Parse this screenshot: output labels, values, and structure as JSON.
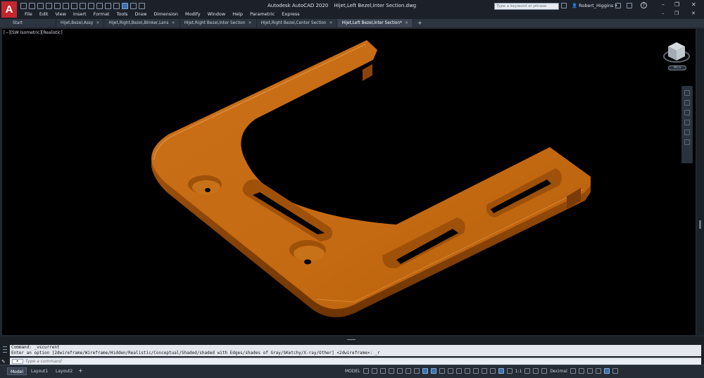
{
  "app": {
    "product": "Autodesk AutoCAD 2020",
    "filename": "Hijet,Left Bezel,Inter Section.dwg",
    "logo_letter": "A",
    "search_placeholder": "Type a keyword or phrase",
    "user": "Robert_Higgins",
    "accent": "#3d6fa8",
    "logo_color": "#c4262e"
  },
  "menu": [
    "File",
    "Edit",
    "View",
    "Insert",
    "Format",
    "Tools",
    "Draw",
    "Dimension",
    "Modify",
    "Window",
    "Help",
    "Parametric",
    "Express"
  ],
  "tabs": [
    {
      "label": "Start",
      "closable": false
    },
    {
      "label": "Hijet,Bezel,Assy",
      "closable": true
    },
    {
      "label": "Hijet,Right,Bezel,Blinker,Lens",
      "closable": true
    },
    {
      "label": "Hijet,Right Bezel,Inter Section",
      "closable": true
    },
    {
      "label": "Hijet,Right Bezel,Center Section",
      "closable": true
    },
    {
      "label": "Hijet,Left Bezel,Inter Section*",
      "closable": true,
      "active": true
    }
  ],
  "viewport": {
    "label": "[−][SW Isometric][Realistic]",
    "model_color": "#c46a12",
    "wcs_label": "WCS"
  },
  "command": {
    "history": [
      "Command: _vscurrent",
      "Enter an option [2dwireframe/Wireframe/Hidden/Realistic/Conceptual/Shaded/shaded with Edges/shades of Gray/SKetchy/X-ray/Other] <2dwireframe>: _r"
    ],
    "placeholder": "Type a command"
  },
  "status": {
    "layouts": [
      "Model",
      "Layout1",
      "Layout2"
    ],
    "active_layout": "Model",
    "model_space": "MODEL",
    "scale": "1:1",
    "units": "Decimal"
  }
}
